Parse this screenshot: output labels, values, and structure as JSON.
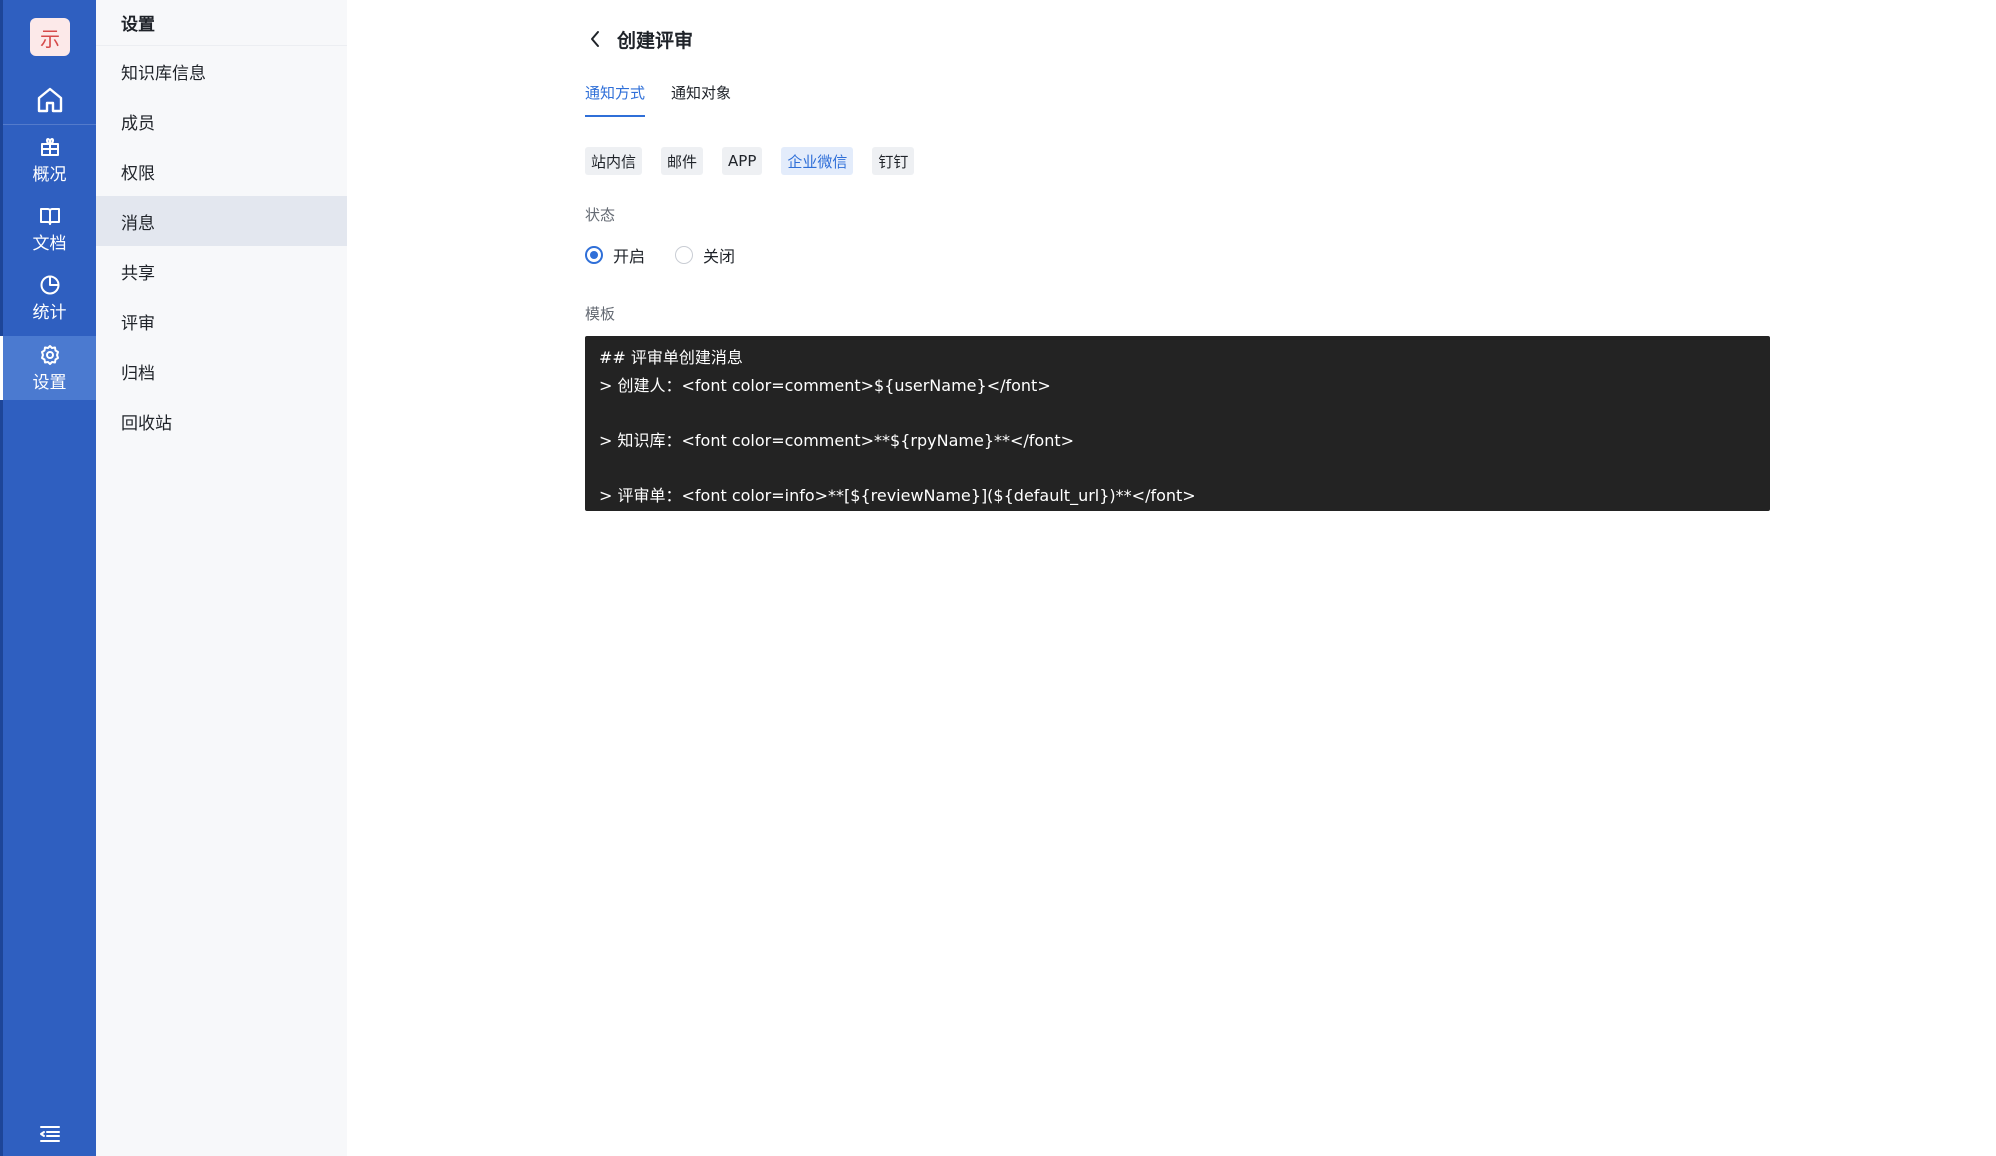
{
  "rail": {
    "logo_char": "示",
    "items": [
      {
        "label": "概况"
      },
      {
        "label": "文档"
      },
      {
        "label": "统计"
      },
      {
        "label": "设置"
      }
    ]
  },
  "sidebar": {
    "title": "设置",
    "items": [
      {
        "label": "知识库信息"
      },
      {
        "label": "成员"
      },
      {
        "label": "权限"
      },
      {
        "label": "消息"
      },
      {
        "label": "共享"
      },
      {
        "label": "评审"
      },
      {
        "label": "归档"
      },
      {
        "label": "回收站"
      }
    ]
  },
  "header": {
    "title": "创建评审"
  },
  "tabs": [
    {
      "label": "通知方式"
    },
    {
      "label": "通知对象"
    }
  ],
  "channels": [
    {
      "label": "站内信"
    },
    {
      "label": "邮件"
    },
    {
      "label": "APP"
    },
    {
      "label": "企业微信"
    },
    {
      "label": "钉钉"
    }
  ],
  "status": {
    "label": "状态",
    "options": [
      {
        "label": "开启"
      },
      {
        "label": "关闭"
      }
    ]
  },
  "template": {
    "label": "模板",
    "lines": [
      "## 评审单创建消息",
      "> 创建人：<font color=comment>${userName}</font>",
      "",
      "> 知识库：<font color=comment>**${rpyName}**</font>",
      "",
      "> 评审单：<font color=info>**[${reviewName}](${default_url})**</font>"
    ]
  },
  "colors": {
    "rail_bg": "#2f5fc0",
    "accent": "#2f6fd8",
    "code_bg": "#232323"
  }
}
